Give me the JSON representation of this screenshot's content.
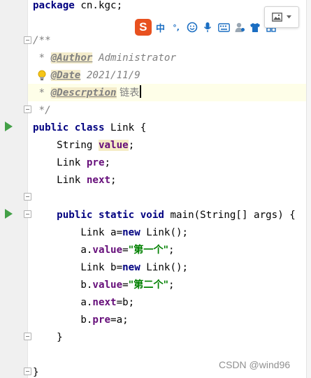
{
  "code": {
    "package_kw": "package",
    "package_name": " cn.kgc;",
    "doc_open": "/**",
    "doc_author_star": " * ",
    "doc_author_tag": "@Author",
    "doc_author_val": " Administrator",
    "doc_date_tag": "@Date",
    "doc_date_val": " 2021/11/9",
    "doc_desc_star": " * ",
    "doc_desc_tag": "@Descrption",
    "doc_desc_val": " 链表",
    "doc_close": " */",
    "class_kw": "public class",
    "class_name": " Link {",
    "f1_type": "    String ",
    "f1_name": "value",
    "f2_type": "    Link ",
    "f2_name": "pre",
    "f3_type": "    Link ",
    "f3_name": "next",
    "semi": ";",
    "main_kw": "    public static void",
    "main_sig": " main(String[] args) {",
    "s1_pre": "        Link a=",
    "new_kw": "new",
    "s1_post": " Link();",
    "s2_pre": "        a.",
    "s2_field": "value",
    "s2_eq": "=",
    "s2_str": "\"第一个\"",
    "s3_pre": "        Link b=",
    "s3_post": " Link();",
    "s4_pre": "        b.",
    "s4_field": "value",
    "s4_eq": "=",
    "s4_str": "\"第二个\"",
    "s5_pre": "        a.",
    "s5_field": "next",
    "s5_post": "=b;",
    "s6_pre": "        b.",
    "s6_field": "pre",
    "s6_post": "=a;",
    "main_close": "    }",
    "class_close": "}"
  },
  "ime_toolbar": {
    "logo": "S",
    "mode": "中",
    "punct": "°,",
    "icons": [
      "smile-icon",
      "microphone-icon",
      "keyboard-icon",
      "user-icon",
      "shirt-icon",
      "grid-icon"
    ]
  },
  "image_button": {
    "icons": [
      "image-icon",
      "chevron-down-icon"
    ]
  },
  "watermark": "CSDN @wind96",
  "colors": {
    "keyword": "#000080",
    "field": "#660e7a",
    "string": "#008000",
    "comment": "#808080",
    "run": "#43a047",
    "ime_accent": "#1b6ec2"
  }
}
